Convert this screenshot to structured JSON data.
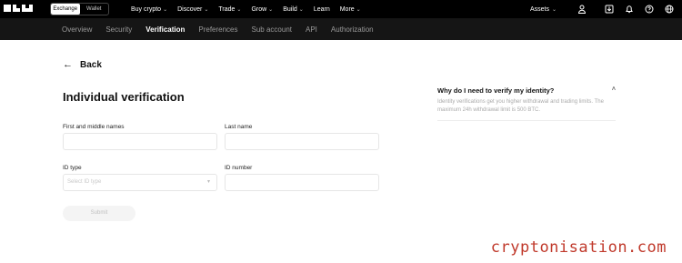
{
  "topbar": {
    "logo_text": "OKX",
    "switch": {
      "exchange": "Exchange",
      "wallet": "Wallet"
    },
    "nav": [
      {
        "label": "Buy crypto",
        "dropdown": true
      },
      {
        "label": "Discover",
        "dropdown": true
      },
      {
        "label": "Trade",
        "dropdown": true
      },
      {
        "label": "Grow",
        "dropdown": true
      },
      {
        "label": "Build",
        "dropdown": true
      },
      {
        "label": "Learn",
        "dropdown": false
      },
      {
        "label": "More",
        "dropdown": true
      }
    ],
    "assets_label": "Assets",
    "icons": [
      "user-icon",
      "download-icon",
      "bell-icon",
      "help-icon",
      "globe-icon"
    ]
  },
  "subnav": {
    "tabs": [
      {
        "label": "Overview",
        "active": false
      },
      {
        "label": "Security",
        "active": false
      },
      {
        "label": "Verification",
        "active": true
      },
      {
        "label": "Preferences",
        "active": false
      },
      {
        "label": "Sub account",
        "active": false
      },
      {
        "label": "API",
        "active": false
      },
      {
        "label": "Authorization",
        "active": false
      }
    ]
  },
  "main": {
    "back_label": "Back",
    "title": "Individual verification",
    "form": {
      "first_names_label": "First and middle names",
      "first_names_value": "",
      "last_name_label": "Last name",
      "last_name_value": "",
      "id_type_label": "ID type",
      "id_type_placeholder": "Select ID type",
      "id_number_label": "ID number",
      "id_number_value": "",
      "submit_label": "Submit"
    }
  },
  "faq": {
    "question": "Why do I need to verify my identity?",
    "answer": "Identity verifications get you higher withdrawal and trading limits. The maximum 24h withdrawal limit is 500 BTC."
  },
  "watermark": "cryptonisation.com",
  "colors": {
    "topbar_bg": "#000000",
    "subnav_bg": "#151515",
    "watermark": "#c0392b"
  }
}
